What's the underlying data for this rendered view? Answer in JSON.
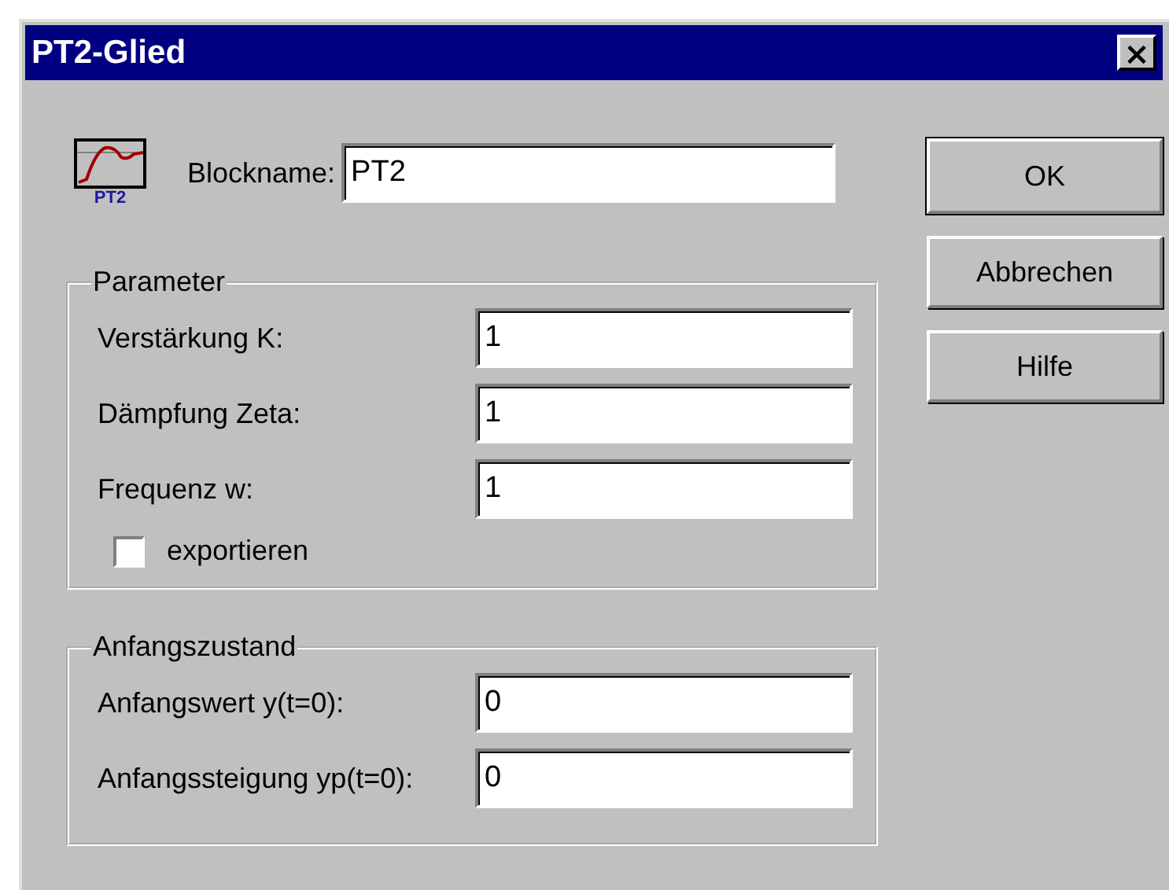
{
  "window": {
    "title": "PT2-Glied",
    "close": "×"
  },
  "block": {
    "icon_caption": "PT2",
    "label": "Blockname:",
    "value": "PT2"
  },
  "groups": [
    {
      "title": "Parameter",
      "fields": [
        {
          "label": "Verstärkung K:",
          "value": "1"
        },
        {
          "label": "Dämpfung Zeta:",
          "value": "1"
        },
        {
          "label": "Frequenz w:",
          "value": "1"
        }
      ],
      "checkbox": {
        "label": "exportieren",
        "checked": false
      }
    },
    {
      "title": "Anfangszustand",
      "fields": [
        {
          "label": "Anfangswert y(t=0):",
          "value": "0"
        },
        {
          "label": "Anfangssteigung yp(t=0):",
          "value": "0"
        }
      ]
    }
  ],
  "buttons": [
    {
      "label": "OK",
      "default": true
    },
    {
      "label": "Abbrechen",
      "default": false
    },
    {
      "label": "Hilfe",
      "default": false
    }
  ]
}
